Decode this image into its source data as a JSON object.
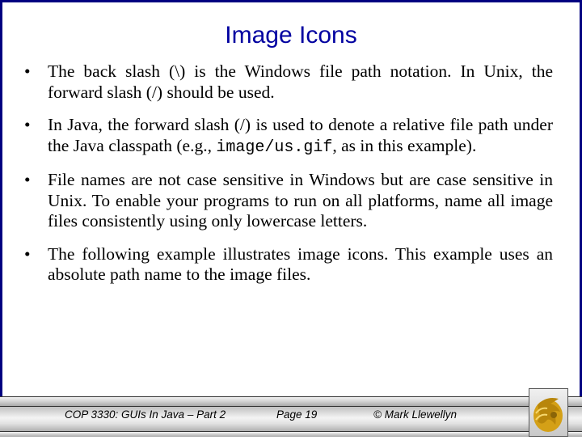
{
  "slide": {
    "title": "Image Icons",
    "bullets": [
      {
        "marker": "•",
        "segments": [
          {
            "text": "The back slash (\\) is the Windows file path notation.  In Unix, the forward slash (/) should be used.",
            "mono": false
          }
        ]
      },
      {
        "marker": "•",
        "segments": [
          {
            "text": "In Java, the forward slash (/) is used to denote a relative file path under the Java classpath (e.g., ",
            "mono": false
          },
          {
            "text": "image/us.gif",
            "mono": true
          },
          {
            "text": ", as in this example).",
            "mono": false
          }
        ]
      },
      {
        "marker": "•",
        "segments": [
          {
            "text": "File names are not case sensitive in Windows but are case sensitive in Unix.  To enable your programs to run on all platforms, name all image files consistently using only lowercase letters.",
            "mono": false
          }
        ]
      },
      {
        "marker": "•",
        "segments": [
          {
            "text": "The following example illustrates image icons.  This example uses an absolute path name to the image files.",
            "mono": false
          }
        ]
      }
    ]
  },
  "footer": {
    "course": "COP 3330:  GUIs In Java – Part 2",
    "page": "Page 19",
    "copyright": "© Mark Llewellyn",
    "logo_icon": "pegasus-logo-icon"
  },
  "colors": {
    "border": "#000080",
    "title": "#0000a0",
    "logo_gold": "#d4a017"
  }
}
